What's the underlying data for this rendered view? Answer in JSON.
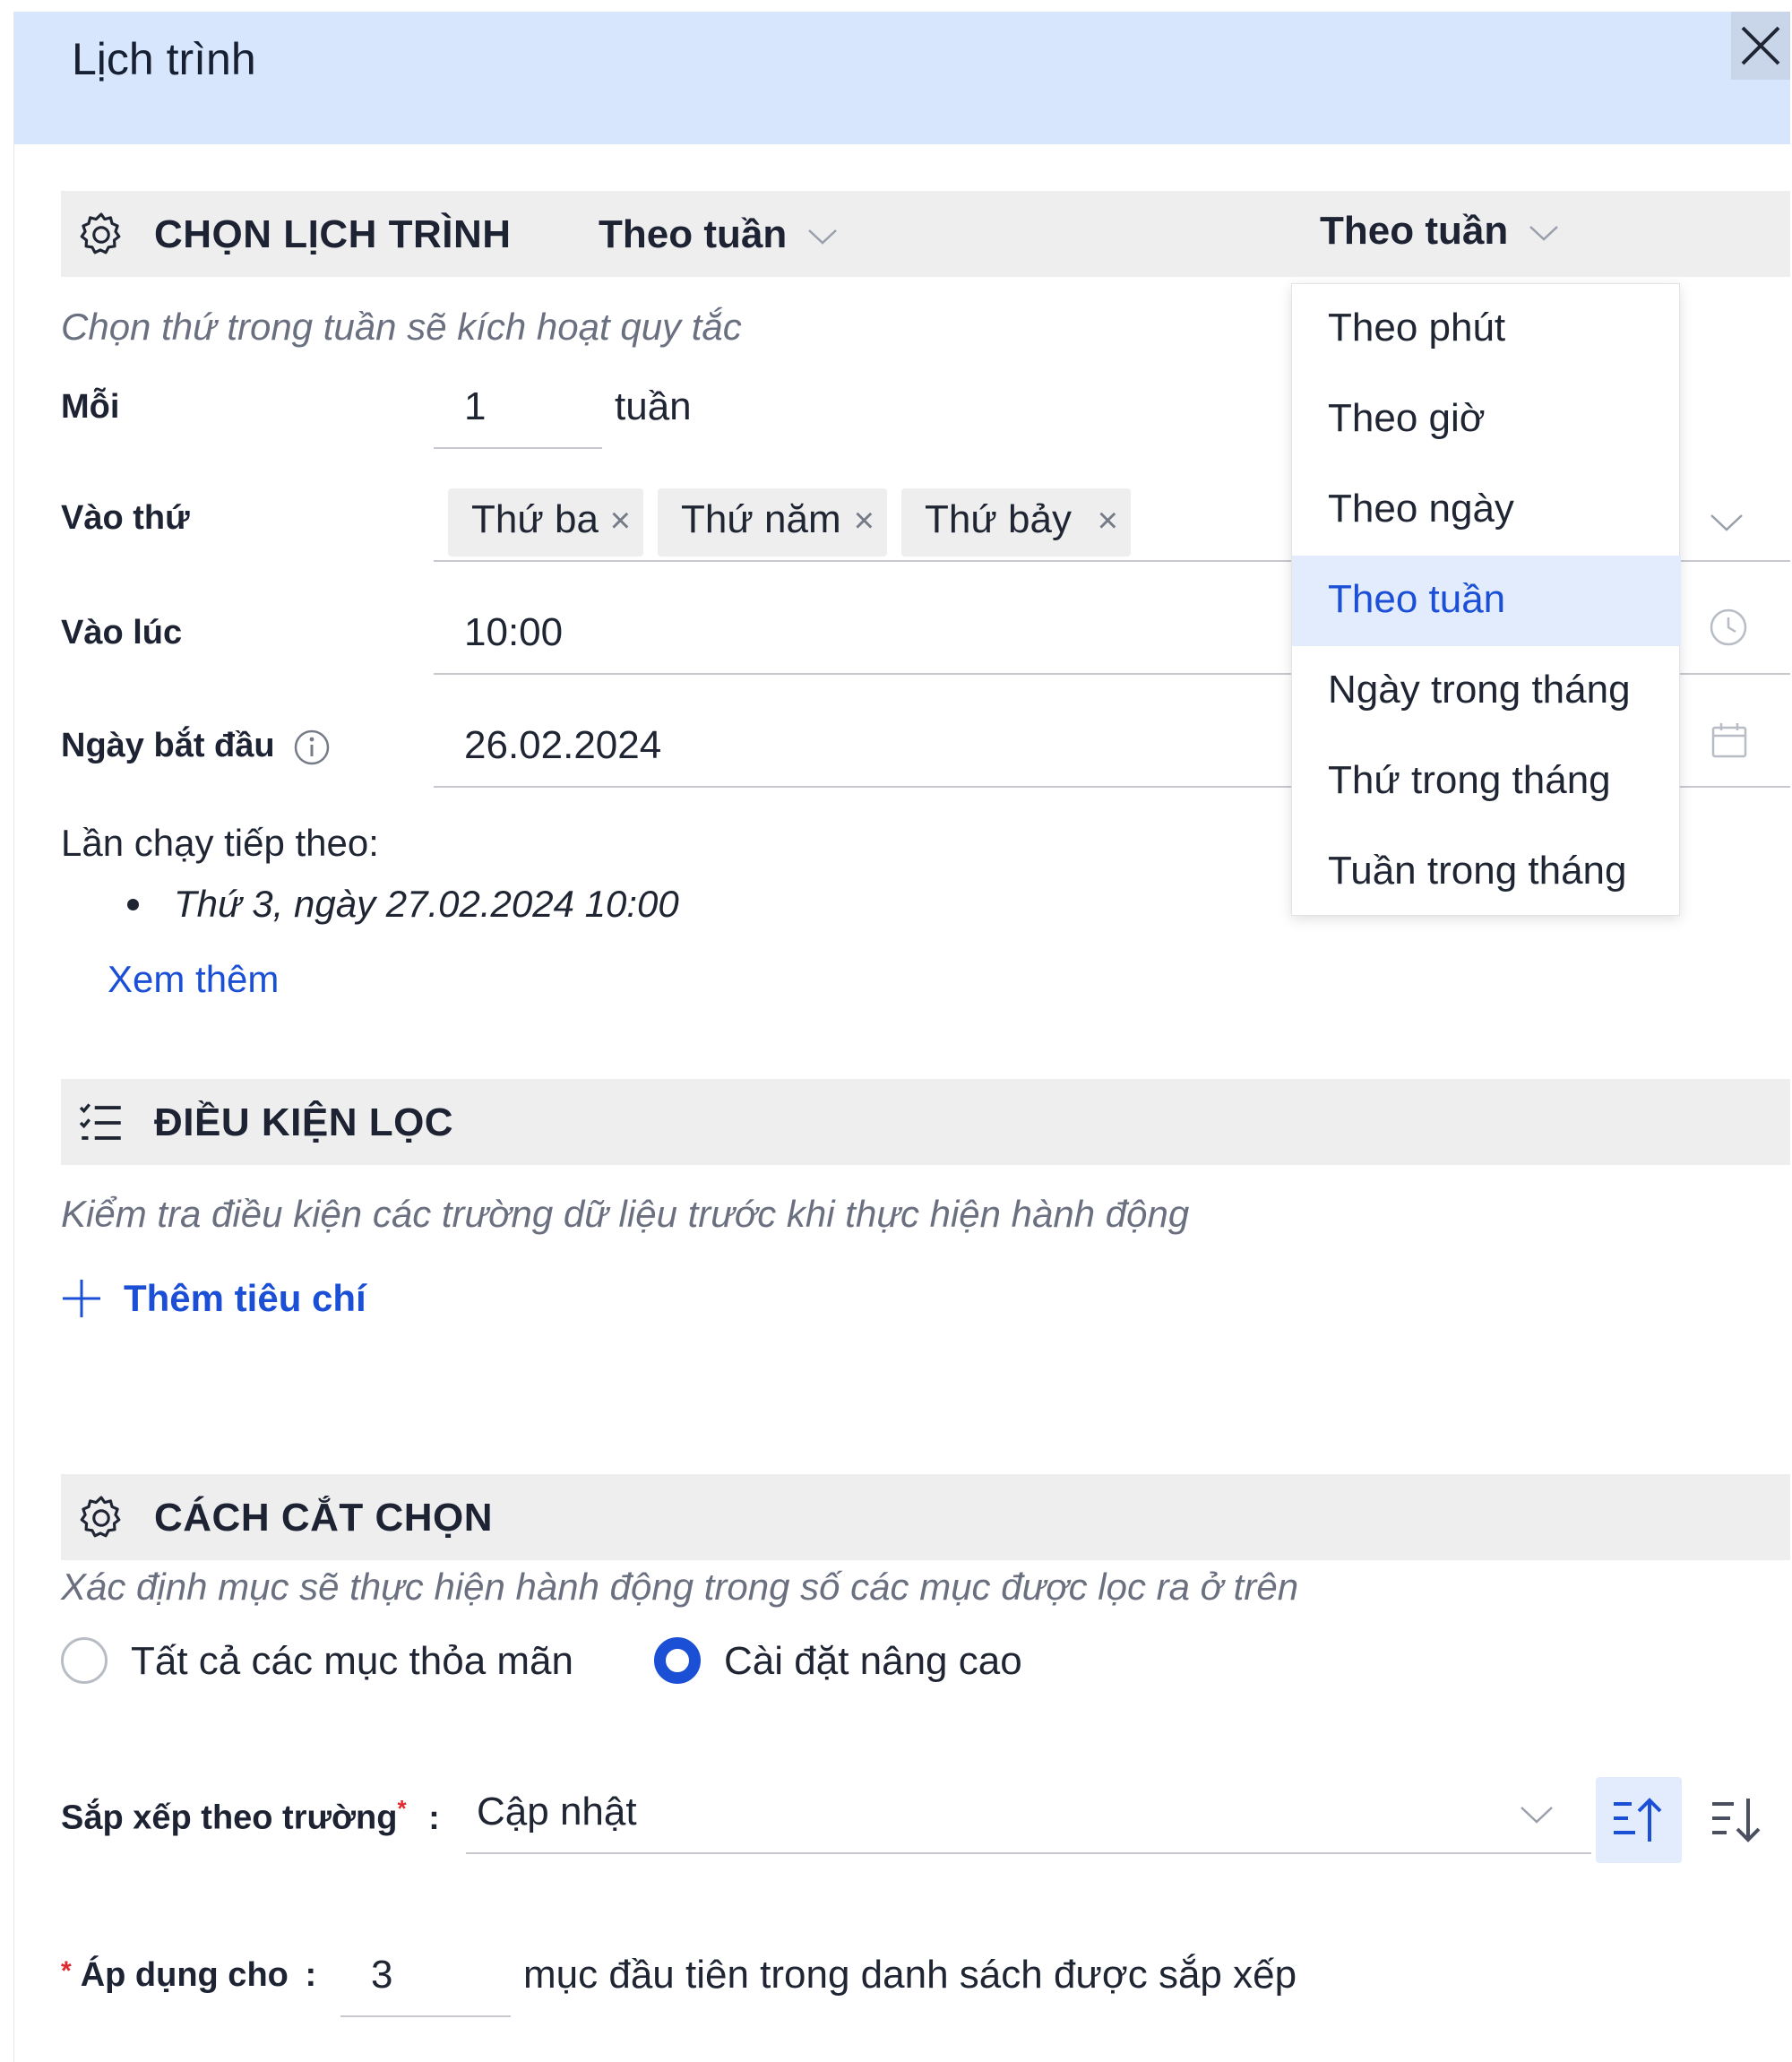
{
  "header": {
    "title": "Lịch trình"
  },
  "schedule": {
    "section_title": "CHỌN LỊCH TRÌNH",
    "frequency_value": "Theo tuần",
    "dropdown_trigger_label": "Theo tuần",
    "hint": "Chọn thứ trong tuần sẽ kích hoạt quy tắc",
    "every_label": "Mỗi",
    "every_value": "1",
    "every_unit": "tuần",
    "days_label": "Vào thứ",
    "days": [
      {
        "label": "Thứ ba"
      },
      {
        "label": "Thứ năm"
      },
      {
        "label": "Thứ bảy"
      }
    ],
    "time_label": "Vào lúc",
    "time_value": "10:00",
    "start_date_label": "Ngày bắt đầu",
    "start_date_value": "26.02.2024",
    "next_run_label": "Lần chạy tiếp theo:",
    "next_runs": [
      "Thứ 3, ngày 27.02.2024 10:00"
    ],
    "see_more": "Xem thêm",
    "options": [
      {
        "label": "Theo phút"
      },
      {
        "label": "Theo giờ"
      },
      {
        "label": "Theo ngày"
      },
      {
        "label": "Theo tuần"
      },
      {
        "label": "Ngày trong tháng"
      },
      {
        "label": "Thứ trong tháng"
      },
      {
        "label": "Tuần trong tháng"
      }
    ],
    "selected_option": "Theo tuần"
  },
  "filter": {
    "section_title": "ĐIỀU KIỆN LỌC",
    "hint": "Kiểm tra điều kiện các trường dữ liệu trước khi thực hiện hành động",
    "add_criteria": "Thêm tiêu chí"
  },
  "selection": {
    "section_title": "CÁCH CẮT CHỌN",
    "hint": "Xác định mục sẽ thực hiện hành động trong số các mục được lọc ra ở trên",
    "option_all": "Tất cả các mục thỏa mãn",
    "option_advanced": "Cài đặt nâng cao",
    "selected": "advanced",
    "sort_label": "Sắp xếp theo trường",
    "required_mark": "*",
    "colon": ":",
    "sort_value": "Cập nhật",
    "apply_label": "Áp dụng cho",
    "apply_value": "3",
    "apply_suffix": "mục đầu tiên trong danh sách được sắp xếp"
  },
  "colors": {
    "accent": "#1a4fd6",
    "header_bg": "#d7e5fd",
    "section_bg": "#eeeeef",
    "required": "#e0282e"
  }
}
